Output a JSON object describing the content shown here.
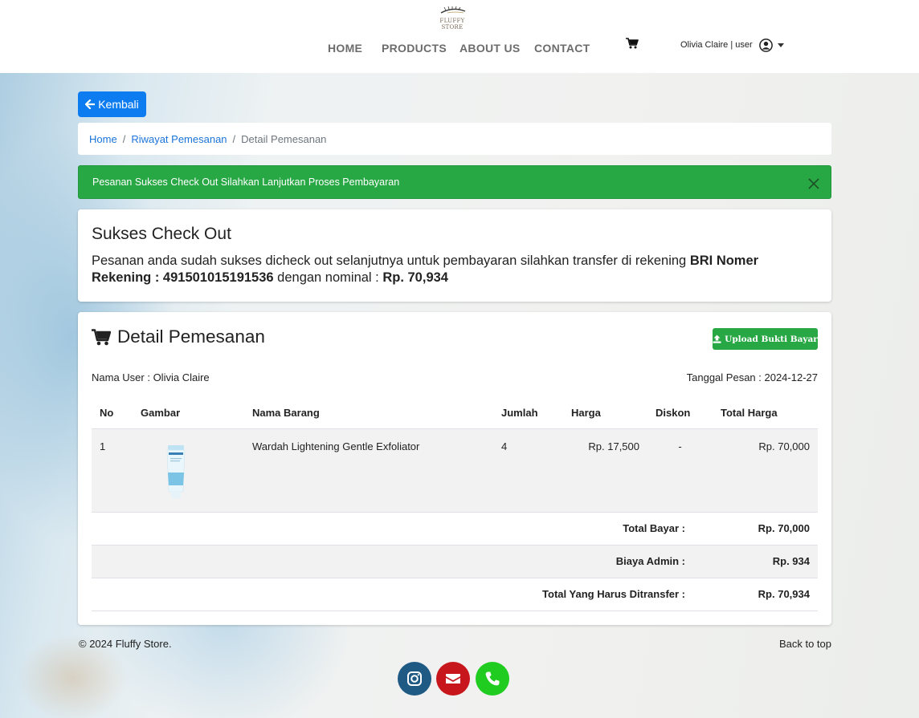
{
  "brand": {
    "name": "FLUFFY STORE"
  },
  "nav": {
    "links": [
      "HOME",
      "PRODUCTS",
      "ABOUT US",
      "CONTACT"
    ],
    "user_label": "Olivia Claire | user"
  },
  "back_button": {
    "label": "Kembali"
  },
  "breadcrumb": {
    "home": "Home",
    "history": "Riwayat Pemesanan",
    "current": "Detail Pemesanan",
    "separator": "/"
  },
  "alert": {
    "message": "Pesanan Sukses Check Out Silahkan Lanjutkan Proses Pembayaran"
  },
  "success_card": {
    "title": "Sukses Check Out",
    "msg_prefix": "Pesanan anda sudah sukses dicheck out selanjutnya untuk pembayaran silahkan transfer di rekening ",
    "msg_bank": "BRI Nomer Rekening : 491501015191536",
    "msg_mid": " dengan nominal : ",
    "msg_amount": "Rp. 70,934"
  },
  "detail": {
    "title": "Detail Pemesanan",
    "upload_label": "Upload Bukti Bayar",
    "user_label": "Nama User : Olivia Claire",
    "date_label": "Tanggal Pesan : 2024-12-27",
    "columns": [
      "No",
      "Gambar",
      "Nama Barang",
      "Jumlah",
      "Harga",
      "Diskon",
      "Total Harga"
    ],
    "items": [
      {
        "no": "1",
        "name": "Wardah Lightening Gentle Exfoliator",
        "qty": "4",
        "price": "Rp. 17,500",
        "discount": "-",
        "total": "Rp. 70,000"
      }
    ],
    "summary": [
      {
        "label": "Total Bayar :",
        "value": "Rp. 70,000"
      },
      {
        "label": "Biaya Admin :",
        "value": "Rp. 934"
      },
      {
        "label": "Total Yang Harus Ditransfer :",
        "value": "Rp. 70,934"
      }
    ]
  },
  "footer": {
    "copyright": "© 2024 Fluffy Store.",
    "back_to_top": "Back to top"
  },
  "colors": {
    "primary": "#0d7cf0",
    "success": "#28a745",
    "instagram": "#1f5a84",
    "email": "#c8161d",
    "whatsapp": "#1fcc1f"
  },
  "icons": {
    "cart": "cart-icon",
    "user": "user-circle-icon",
    "back": "arrow-left-icon",
    "upload": "upload-icon",
    "close": "close-icon",
    "instagram": "instagram-icon",
    "email": "envelope-icon",
    "phone": "phone-icon"
  }
}
